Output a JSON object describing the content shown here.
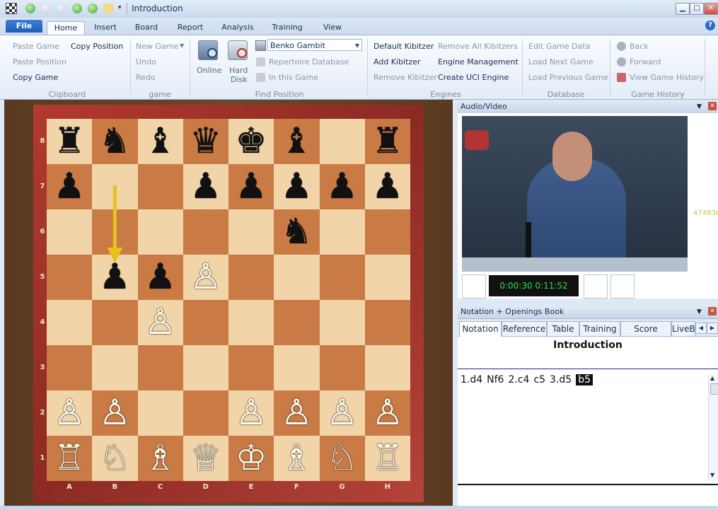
{
  "window": {
    "title": "Introduction",
    "min": "▁",
    "max": "□",
    "close": "✕"
  },
  "tabs": {
    "file": "File",
    "items": [
      "Home",
      "Insert",
      "Board",
      "Report",
      "Analysis",
      "Training",
      "View"
    ],
    "active": "Home"
  },
  "ribbon": {
    "clipboard": {
      "paste_game": "Paste Game",
      "copy_position": "Copy Position",
      "paste_position": "Paste Position",
      "copy_game": "Copy Game",
      "label": "Clipboard"
    },
    "game": {
      "new_game": "New Game",
      "undo": "Undo",
      "redo": "Redo",
      "label": "game"
    },
    "find_position": {
      "online": "Online",
      "hard_disk_line1": "Hard",
      "hard_disk_line2": "Disk",
      "opening_select": "Benko Gambit",
      "repertoire": "Repertoire Database",
      "in_this_game": "In this Game",
      "label": "Find Position"
    },
    "engines": {
      "default_kibitzer": "Default Kibitzer",
      "remove_all": "Remove All Kibitzers",
      "add_kibitzer": "Add Kibitzer",
      "engine_management": "Engine Management",
      "remove_kibitzer": "Remove Kibitzer",
      "create_uci": "Create UCI Engine",
      "label": "Engines"
    },
    "database": {
      "edit_game_data": "Edit Game Data",
      "load_next": "Load Next Game",
      "load_previous": "Load Previous Game",
      "label": "Database"
    },
    "history": {
      "back": "Back",
      "forward": "Forward",
      "view_history": "View Game History",
      "label": "Game History"
    }
  },
  "board": {
    "ranks": [
      "8",
      "7",
      "6",
      "5",
      "4",
      "3",
      "2",
      "1"
    ],
    "files": [
      "A",
      "B",
      "C",
      "D",
      "E",
      "F",
      "G",
      "H"
    ],
    "pieces": [
      {
        "sq": "a8",
        "p": "r",
        "c": "b"
      },
      {
        "sq": "b8",
        "p": "n",
        "c": "b"
      },
      {
        "sq": "c8",
        "p": "b",
        "c": "b"
      },
      {
        "sq": "d8",
        "p": "q",
        "c": "b"
      },
      {
        "sq": "e8",
        "p": "k",
        "c": "b"
      },
      {
        "sq": "f8",
        "p": "b",
        "c": "b"
      },
      {
        "sq": "h8",
        "p": "r",
        "c": "b"
      },
      {
        "sq": "a7",
        "p": "p",
        "c": "b"
      },
      {
        "sq": "d7",
        "p": "p",
        "c": "b"
      },
      {
        "sq": "e7",
        "p": "p",
        "c": "b"
      },
      {
        "sq": "f7",
        "p": "p",
        "c": "b"
      },
      {
        "sq": "g7",
        "p": "p",
        "c": "b"
      },
      {
        "sq": "h7",
        "p": "p",
        "c": "b"
      },
      {
        "sq": "f6",
        "p": "n",
        "c": "b"
      },
      {
        "sq": "b5",
        "p": "p",
        "c": "b"
      },
      {
        "sq": "c5",
        "p": "p",
        "c": "b"
      },
      {
        "sq": "d5",
        "p": "p",
        "c": "w"
      },
      {
        "sq": "c4",
        "p": "p",
        "c": "w"
      },
      {
        "sq": "a2",
        "p": "p",
        "c": "w"
      },
      {
        "sq": "b2",
        "p": "p",
        "c": "w"
      },
      {
        "sq": "e2",
        "p": "p",
        "c": "w"
      },
      {
        "sq": "f2",
        "p": "p",
        "c": "w"
      },
      {
        "sq": "g2",
        "p": "p",
        "c": "w"
      },
      {
        "sq": "h2",
        "p": "p",
        "c": "w"
      },
      {
        "sq": "a1",
        "p": "r",
        "c": "w"
      },
      {
        "sq": "b1",
        "p": "n",
        "c": "w"
      },
      {
        "sq": "c1",
        "p": "b",
        "c": "w"
      },
      {
        "sq": "d1",
        "p": "q",
        "c": "w"
      },
      {
        "sq": "e1",
        "p": "k",
        "c": "w"
      },
      {
        "sq": "f1",
        "p": "b",
        "c": "w"
      },
      {
        "sq": "g1",
        "p": "n",
        "c": "w"
      },
      {
        "sq": "h1",
        "p": "r",
        "c": "w"
      }
    ],
    "arrow": {
      "from": "b7",
      "to": "b5",
      "color": "#e6c21b"
    }
  },
  "audio_video": {
    "header": "Audio/Video",
    "time": "0:00:30 0:11:52",
    "side_counter": "474836"
  },
  "notation": {
    "header": "Notation + Openings Book",
    "tabs": [
      "Notation",
      "Reference",
      "Table",
      "Training",
      "Score sheet",
      "LiveB"
    ],
    "title": "Introduction",
    "moves": [
      "1.d4",
      "Nf6",
      "2.c4",
      "c5",
      "3.d5",
      "b5"
    ],
    "selected_move": "b5"
  }
}
